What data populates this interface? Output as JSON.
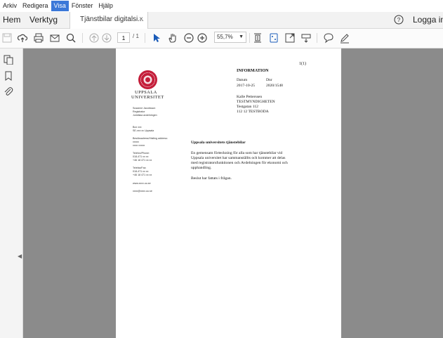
{
  "menu": [
    "Arkiv",
    "Redigera",
    "Visa",
    "Fönster",
    "Hjälp"
  ],
  "active_menu": "Visa",
  "nav_tabs": {
    "home": "Hem",
    "tools": "Verktyg"
  },
  "doc_tab": {
    "title": "Tjänstbilar digitalsi...",
    "close": "×"
  },
  "login": "Logga in",
  "toolbar": {
    "page_current": "1",
    "page_total": "/ 1",
    "zoom": "55,7%"
  },
  "document": {
    "page_number": "1(1)",
    "heading": "INFORMATION",
    "date_label": "Datum",
    "date_value": "2017-10-25",
    "ref_label": "Dnr",
    "ref_value": "2020/1548",
    "recipient": [
      "Kalle Petterssen",
      "TESTMYNDIGHETEN",
      "Testgatan 112",
      "112 12 TESTBODA"
    ],
    "logo_line1": "UPPSALA",
    "logo_line2": "UNIVERSITET",
    "sender": [
      "Susanne Jacobsson",
      "Registrator",
      "Juridiska avdelningen"
    ],
    "contact": [
      "Box xxx",
      "SE-xxx xx Uppsala",
      "",
      "Besöksadress/Visiting address:",
      "xxxxx",
      "xxxx xxxxx",
      "",
      "Telefon/Phone:",
      "018-471 xx xx",
      "+46 18 471 xx xx",
      "",
      "Telefax/Fax:",
      "018-471 xx xx",
      "+46 18 471 xx xx",
      "",
      "www.xxxx.uu.se",
      "",
      "xxxx@xxxx.uu.se"
    ],
    "subject": "Uppsala universitets tjänstebilar",
    "body": [
      "En gemensam förteckning för alla som har tjänstebilar vid",
      "Uppsala universitet har sammanställts och kommer att delas",
      "med registratorsfunktionen och Avdelningen för ekonomi och",
      "upphandling."
    ],
    "decision": "Beslut har fattats i frågan."
  }
}
